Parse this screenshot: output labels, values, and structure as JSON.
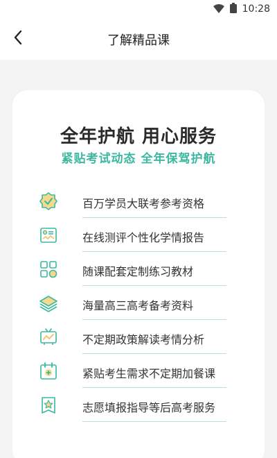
{
  "status_bar": {
    "time": "10:28",
    "icons": [
      "wifi-icon",
      "battery-icon"
    ]
  },
  "header": {
    "title": "了解精品课",
    "back_icon": "chevron-left-icon"
  },
  "card": {
    "headline": "全年护航 用心服务",
    "subhead": "紧贴考试动态 全年保驾护航",
    "features": [
      {
        "icon": "badge-check-icon",
        "label": "百万学员大联考参考资格"
      },
      {
        "icon": "report-card-icon",
        "label": "在线测评个性化学情报告"
      },
      {
        "icon": "apps-grid-icon",
        "label": "随课配套定制练习教材"
      },
      {
        "icon": "layers-icon",
        "label": "海量高三高考备考资料"
      },
      {
        "icon": "tv-chart-icon",
        "label": "不定期政策解读考情分析"
      },
      {
        "icon": "calendar-plus-icon",
        "label": "紧贴考生需求不定期加餐课"
      },
      {
        "icon": "certificate-star-icon",
        "label": "志愿填报指导等后高考服务"
      }
    ]
  },
  "colors": {
    "accent": "#3bb89f",
    "icon_fill": "#f6d98c",
    "background": "#f3f3f3"
  }
}
